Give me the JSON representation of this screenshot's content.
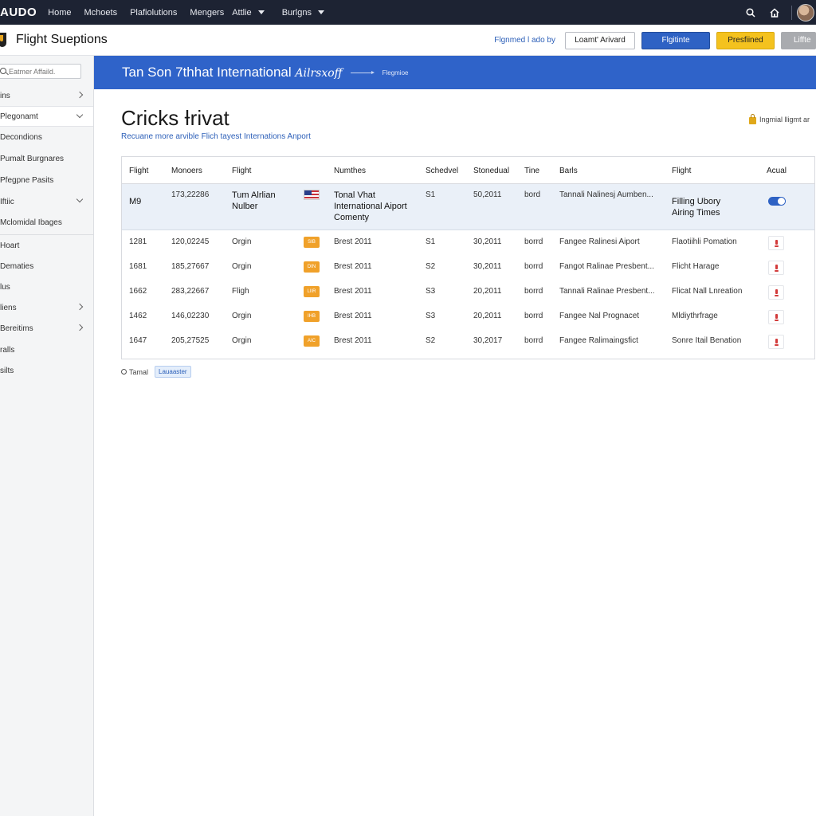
{
  "topnav": {
    "brand": "AUDO",
    "links": [
      "Home",
      "Mchoets",
      "Plafiolutions",
      "Mengers",
      "Attlie",
      "Burlgns"
    ],
    "colors": {
      "bar": "#1d2333"
    }
  },
  "subheader": {
    "title": "Flight Sueptions",
    "link": "Flgnmed l ado by",
    "buttons": [
      "Loamt' Arivard",
      "Flgitinte",
      "Presfiined",
      "Liffte"
    ]
  },
  "sidebar": {
    "search_placeholder": "Eatmer Affaild.",
    "items": [
      {
        "label": "ins",
        "chevron": "right"
      },
      {
        "label": "Plegonamt",
        "chevron": "down",
        "active": true
      },
      {
        "label": "Decondions",
        "chevron": ""
      },
      {
        "label": "Pumalt Burgnares",
        "chevron": ""
      },
      {
        "label": "Pfegpne Pasits",
        "chevron": ""
      },
      {
        "label": "Iftiic",
        "chevron": "down"
      },
      {
        "label": "Mclomidal Ibages",
        "chevron": ""
      },
      {
        "label": "Hoart",
        "chevron": ""
      },
      {
        "label": "Dematies",
        "chevron": ""
      },
      {
        "label": "lus",
        "chevron": ""
      },
      {
        "label": "liens",
        "chevron": "right"
      },
      {
        "label": "Bereitims",
        "chevron": "right"
      },
      {
        "label": "ralls",
        "chevron": ""
      },
      {
        "label": "silts",
        "chevron": ""
      }
    ]
  },
  "banner": {
    "title_plain": "Tan Son 7thhat International ",
    "title_script": "Ailrsxoff",
    "sub": "Flegmioe",
    "color": "#2f63c9"
  },
  "page": {
    "title": "Cricks Ɨrivat",
    "subtitle": "Recuane more arvible Flich tayest Internations Anport",
    "corner_link": "Ingmial lligmt ar"
  },
  "table": {
    "headers": [
      "Flight",
      "Monoers",
      "Flight",
      "Numthes",
      "Schedvel",
      "Stonedual",
      "Tine",
      "Barls",
      "Flight",
      "Acual"
    ],
    "highlight_row": {
      "flight": "M9",
      "number": "173,22286",
      "airline": "Tum Alrlian Nulber",
      "name": "Tonal Vhat International Aiport Comenty",
      "sched": "S1",
      "stoned": "50,2011",
      "time": "bord",
      "barls": "Tannali Nalinesj Aumben...",
      "flight2": "Filling Ubory Airing Times",
      "toggle": true
    },
    "rows": [
      {
        "flight": "1281",
        "number": "120,02245",
        "origin": "Orgin",
        "tag": "SIB",
        "name": "Brest 2011",
        "sched": "S1",
        "stoned": "30,2011",
        "time": "borrd",
        "barls": "Fangee Ralinesi Aiport",
        "flight2": "Flaotiihli Pomation"
      },
      {
        "flight": "1681",
        "number": "185,27667",
        "origin": "Orgin",
        "tag": "DIN",
        "name": "Brest 2011",
        "sched": "S2",
        "stoned": "30,2011",
        "time": "borrd",
        "barls": "Fangot Ralinae Presbent...",
        "flight2": "Flicht Harage"
      },
      {
        "flight": "1662",
        "number": "283,22667",
        "origin": "Fligh",
        "tag": "LIIR",
        "name": "Brest 2011",
        "sched": "S3",
        "stoned": "20,2011",
        "time": "borrd",
        "barls": "Tannali Ralinae Presbent...",
        "flight2": "Flicat Nall Lnreation"
      },
      {
        "flight": "1462",
        "number": "146,02230",
        "origin": "Orgin",
        "tag": "IHB",
        "name": "Brest 2011",
        "sched": "S3",
        "stoned": "20,2011",
        "time": "borrd",
        "barls": "Fangee Nal Prognacet",
        "flight2": "Mldiythrfrage"
      },
      {
        "flight": "1647",
        "number": "205,27525",
        "origin": "Orgin",
        "tag": "AIC",
        "name": "Brest 2011",
        "sched": "S2",
        "stoned": "30,2017",
        "time": "borrd",
        "barls": "Fangee Ralimaingsfict",
        "flight2": "Sonre Itail Benation"
      }
    ]
  },
  "footer": {
    "label": "Tamal",
    "badge": "Lauaaster"
  }
}
